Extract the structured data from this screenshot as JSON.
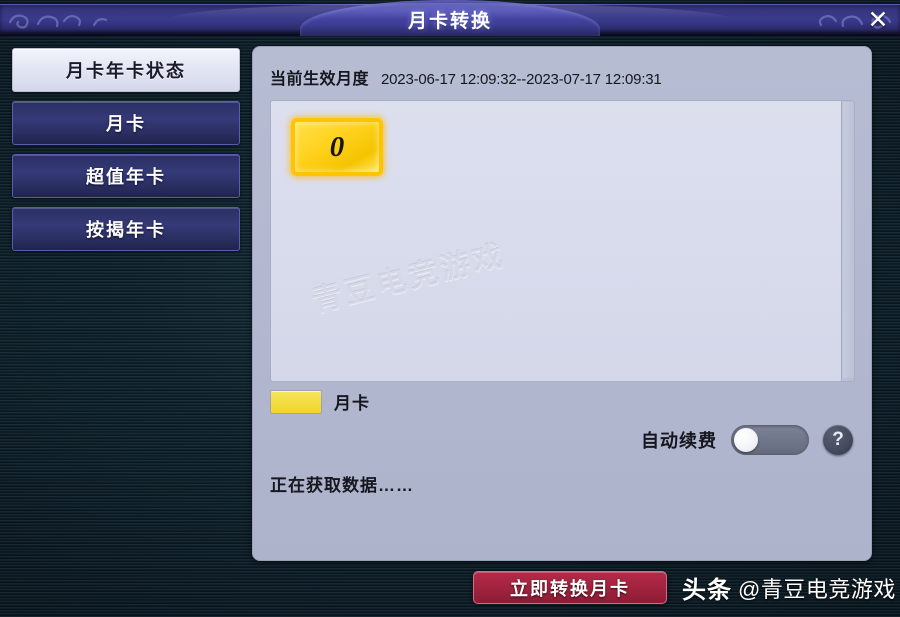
{
  "window": {
    "title": "月卡转换",
    "close_label": "✕"
  },
  "sidebar": {
    "items": [
      {
        "label": "月卡年卡状态",
        "state": "active"
      },
      {
        "label": "月卡",
        "state": "inactive"
      },
      {
        "label": "超值年卡",
        "state": "inactive"
      },
      {
        "label": "按揭年卡",
        "state": "inactive"
      }
    ]
  },
  "main": {
    "period": {
      "label": "当前生效月度",
      "value": "2023-06-17 12:09:32--2023-07-17 12:09:31"
    },
    "card_list": {
      "items": [
        {
          "count": "0",
          "type": "月卡",
          "color": "#ffd21f"
        }
      ],
      "watermark": "青豆电竞游戏"
    },
    "legend": {
      "label": "月卡",
      "color": "#f2dc3d"
    },
    "auto_renew": {
      "label": "自动续费",
      "enabled": false,
      "help_label": "?"
    },
    "status": "正在获取数据……"
  },
  "footer": {
    "convert_label": "立即转换月卡"
  },
  "watermark": {
    "brand": "头条",
    "handle": "@青豆电竞游戏"
  },
  "colors": {
    "accent_red": "#a32440",
    "card_yellow": "#ffd21f",
    "panel": "#b2b8cf",
    "title_blue": "#3a3a8c"
  }
}
